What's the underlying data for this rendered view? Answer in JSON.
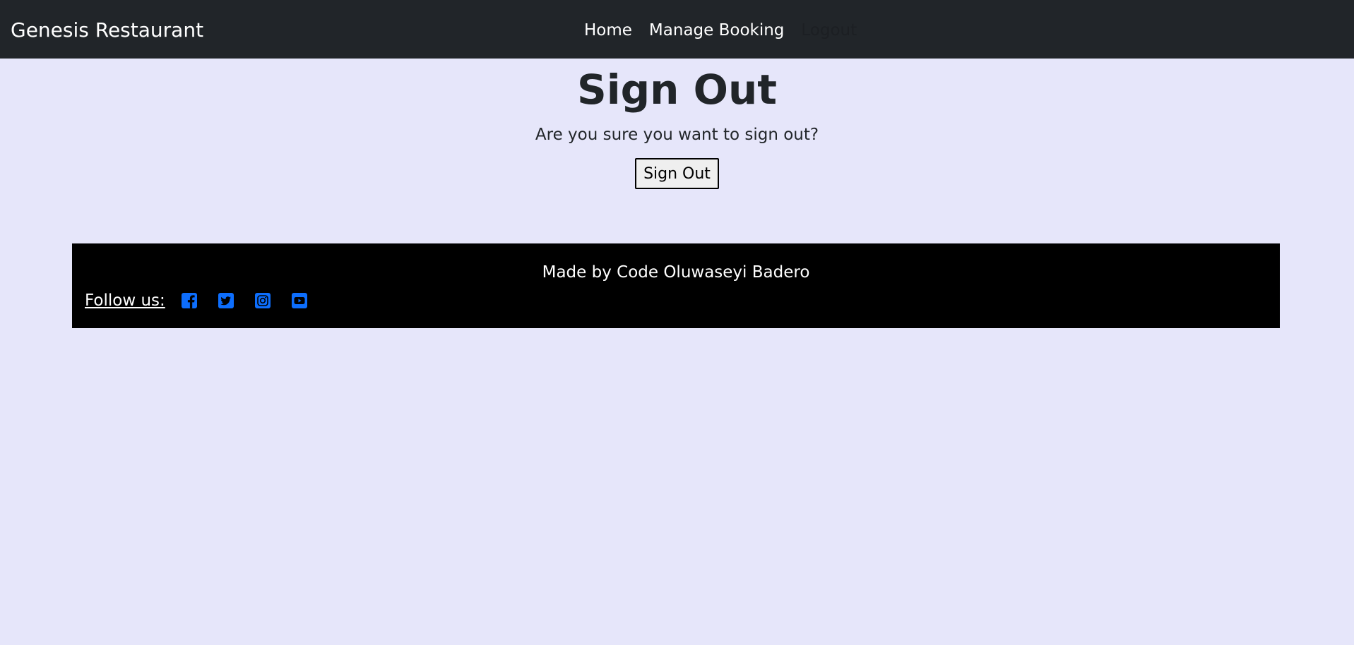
{
  "navbar": {
    "brand": "Genesis Restaurant",
    "links": [
      {
        "label": "Home"
      },
      {
        "label": "Manage Booking"
      },
      {
        "label": "Logout"
      }
    ]
  },
  "main": {
    "title": "Sign Out",
    "confirm_text": "Are you sure you want to sign out?",
    "button_label": "Sign Out"
  },
  "footer": {
    "credit": "Made by Code Oluwaseyi Badero",
    "follow_label": "Follow us:",
    "social_icons": [
      "facebook-icon",
      "twitter-icon",
      "instagram-icon",
      "youtube-icon"
    ]
  },
  "colors": {
    "page_bg": "#e6e6fa",
    "navbar_bg": "#212529",
    "footer_bg": "#000000",
    "social_icon": "#0d6efd"
  }
}
